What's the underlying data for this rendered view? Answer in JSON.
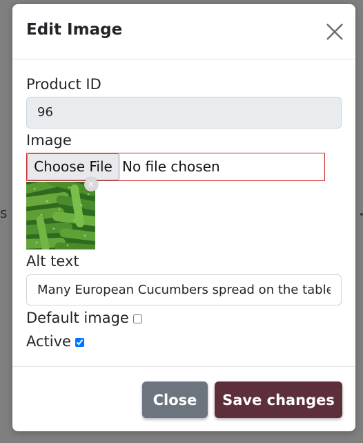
{
  "backdrop": {
    "partial_text": "s"
  },
  "modal": {
    "title": "Edit Image",
    "close_icon": "close-icon"
  },
  "form": {
    "product_id_label": "Product ID",
    "product_id_value": "96",
    "image_label": "Image",
    "file_button_label": "Choose File",
    "file_status": "No file chosen",
    "thumbnail_remove_icon": "remove-x-icon",
    "alt_text_label": "Alt text",
    "alt_text_value": "Many European Cucumbers spread on the table",
    "default_image_label": "Default image",
    "default_image_checked": false,
    "active_label": "Active",
    "active_checked": true
  },
  "footer": {
    "close_label": "Close",
    "save_label": "Save changes"
  },
  "colors": {
    "save_button": "#5c2f3a",
    "close_button": "#6c757d",
    "file_input_border": "#c92a2a"
  }
}
